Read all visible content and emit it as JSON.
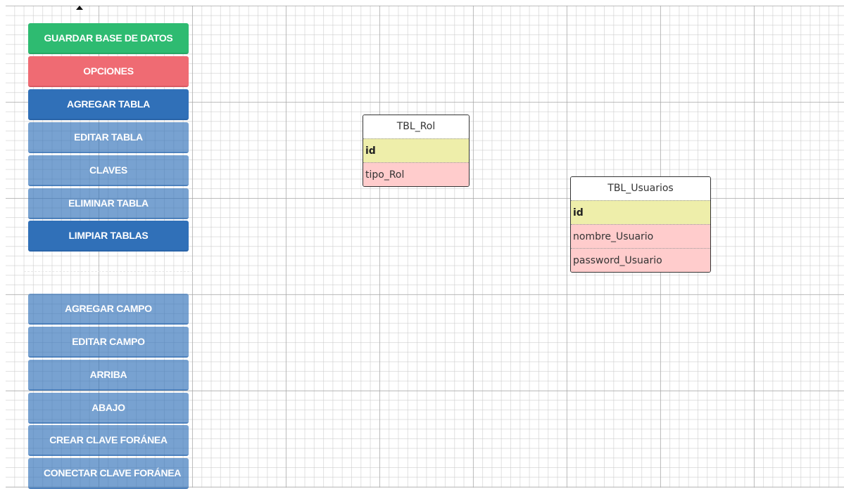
{
  "toolbar": {
    "save_db": "GUARDAR BASE DE DATOS",
    "options": "OPCIONES",
    "add_table": "AGREGAR TABLA",
    "edit_table": "EDITAR TABLA",
    "keys": "CLAVES",
    "delete_table": "ELIMINAR TABLA",
    "clear_tables": "LIMPIAR TABLAS",
    "add_field": "AGREGAR CAMPO",
    "edit_field": "EDITAR CAMPO",
    "up": "ARRIBA",
    "down": "ABAJO",
    "create_fk": "CREAR CLAVE FORÁNEA",
    "connect_fk": "CONECTAR CLAVE FORÁNEA"
  },
  "tables": [
    {
      "name": "TBL_Rol",
      "fields": [
        {
          "name": "id",
          "primary": true
        },
        {
          "name": "tipo_Rol",
          "primary": false
        }
      ]
    },
    {
      "name": "TBL_Usuarios",
      "fields": [
        {
          "name": "id",
          "primary": true
        },
        {
          "name": "nombre_Usuario",
          "primary": false
        },
        {
          "name": "password_Usuario",
          "primary": false
        }
      ]
    }
  ],
  "colors": {
    "save": "#2ebb71",
    "options": "#ef6b73",
    "primary_blue": "#3070b8",
    "pk_field": "#eeeeaa",
    "normal_field": "#ffcccc"
  }
}
